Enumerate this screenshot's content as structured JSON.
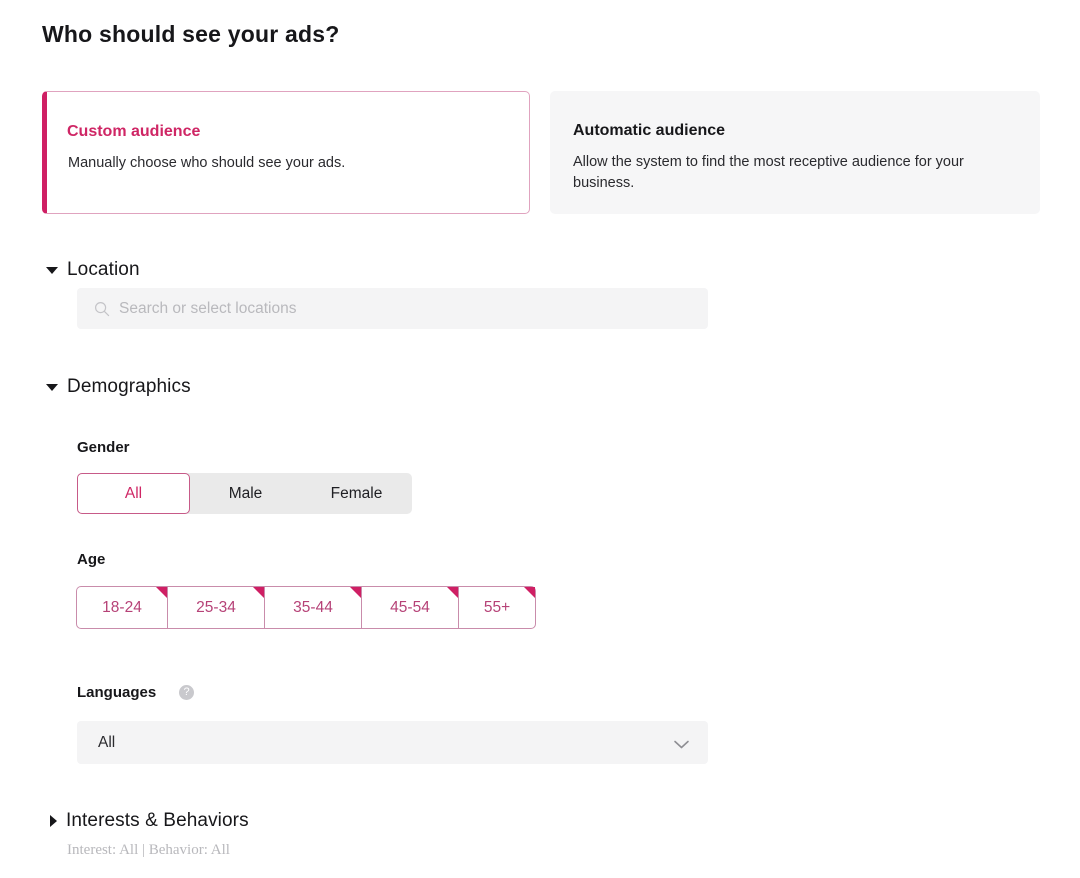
{
  "page": {
    "title": "Who should see your ads?"
  },
  "audience_options": [
    {
      "id": "custom",
      "title": "Custom audience",
      "description": "Manually choose who should see your ads.",
      "selected": true
    },
    {
      "id": "automatic",
      "title": "Automatic audience",
      "description": "Allow the system to find the most receptive audience for your business.",
      "selected": false
    }
  ],
  "location": {
    "section_label": "Location",
    "expanded": true,
    "search_placeholder": "Search or select locations",
    "search_value": "",
    "search_icon": "search-icon"
  },
  "demographics": {
    "section_label": "Demographics",
    "expanded": true,
    "gender": {
      "label": "Gender",
      "options": [
        {
          "label": "All",
          "selected": true
        },
        {
          "label": "Male",
          "selected": false
        },
        {
          "label": "Female",
          "selected": false
        }
      ]
    },
    "age": {
      "label": "Age",
      "options": [
        {
          "label": "18-24",
          "selected": true
        },
        {
          "label": "25-34",
          "selected": true
        },
        {
          "label": "35-44",
          "selected": true
        },
        {
          "label": "45-54",
          "selected": true
        },
        {
          "label": "55+",
          "selected": true
        }
      ]
    },
    "languages": {
      "label": "Languages",
      "help_icon": "help-circle-icon",
      "help_glyph": "?",
      "selected_value": "All",
      "chevron_icon": "chevron-down-icon"
    }
  },
  "interests": {
    "section_label": "Interests & Behaviors",
    "expanded": false,
    "summary": "Interest: All | Behavior: All"
  },
  "colors": {
    "accent": "#cf1f64",
    "accent_text": "#cf2665",
    "chip_border": "#c98cab",
    "card_muted_bg": "#f6f6f7",
    "field_bg": "#f4f4f5",
    "placeholder": "#b9b9bd",
    "muted_text": "#b8b8bc"
  }
}
